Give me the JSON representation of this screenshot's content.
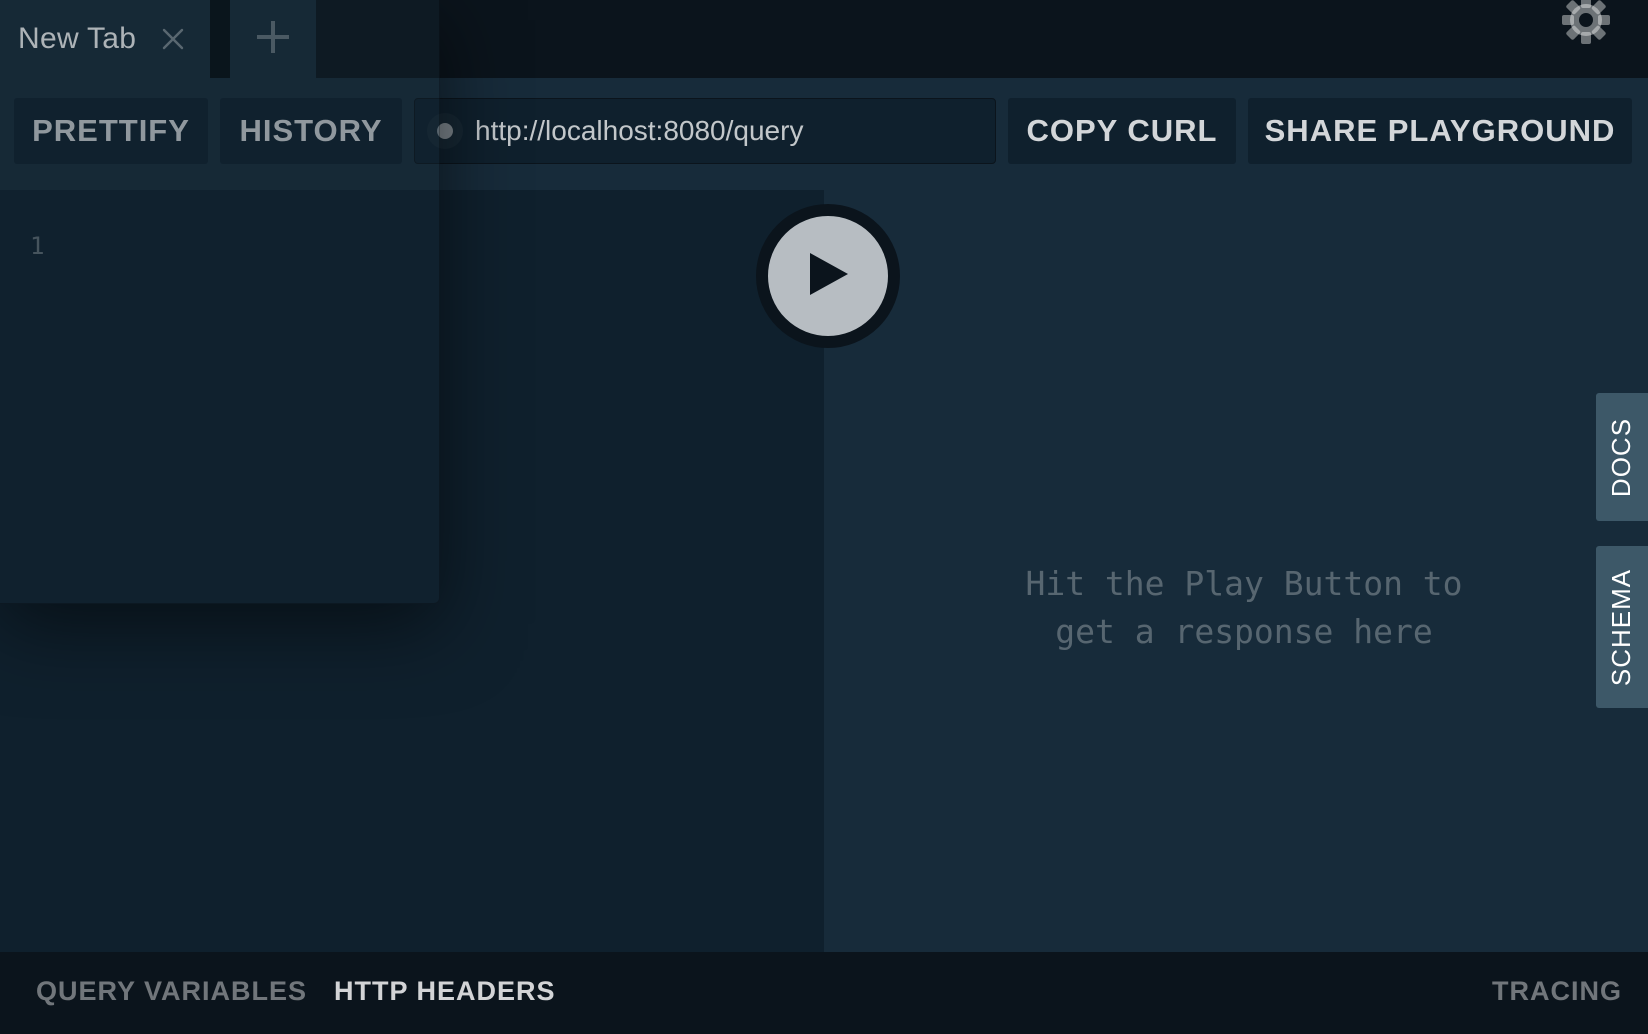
{
  "tabs": [
    {
      "label": "New Tab"
    }
  ],
  "toolbar": {
    "prettify_label": "PRETTIFY",
    "history_label": "HISTORY",
    "url": "http://localhost:8080/query",
    "copy_curl_label": "COPY CURL",
    "share_label": "SHARE PLAYGROUND"
  },
  "editor": {
    "line_numbers": [
      "1"
    ]
  },
  "result": {
    "placeholder": "Hit the Play Button to\nget a response here"
  },
  "side_tabs": {
    "docs_label": "DOCS",
    "schema_label": "SCHEMA"
  },
  "bottom": {
    "query_variables_label": "QUERY VARIABLES",
    "http_headers_label": "HTTP HEADERS",
    "tracing_label": "TRACING"
  },
  "icons": {
    "close": "close-icon",
    "add": "plus-icon",
    "settings": "gear-icon",
    "play": "play-icon"
  },
  "colors": {
    "background_dark": "#0f202d",
    "background_panel": "#172b3a",
    "chrome": "#0b141c",
    "side_tab": "#3d5868",
    "play_button": "#b7bdc2"
  }
}
